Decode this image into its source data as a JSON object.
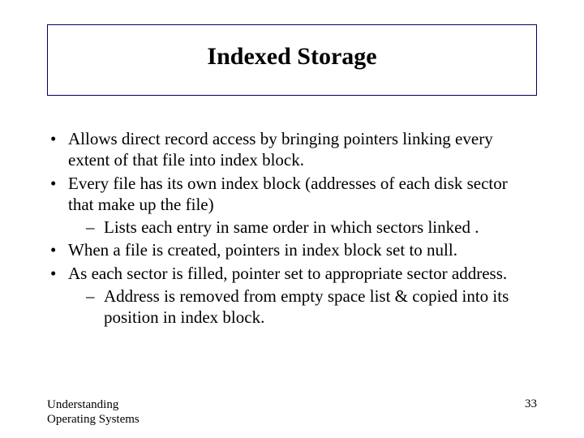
{
  "title": "Indexed Storage",
  "bullets": {
    "b0": "Allows direct record access by bringing pointers linking every extent of that file into index block.",
    "b1": "Every file has its own index block (addresses of each disk sector that make up the file)",
    "b1_sub0": "Lists each entry in same order in which sectors linked .",
    "b2": "When a file is created, pointers in index block set to null.",
    "b3": "As each sector is filled, pointer set to appropriate sector address.",
    "b3_sub0": "Address is removed from empty space list & copied into its position in index block."
  },
  "footer": {
    "left_line1": "Understanding",
    "left_line2": "Operating Systems",
    "page": "33"
  }
}
